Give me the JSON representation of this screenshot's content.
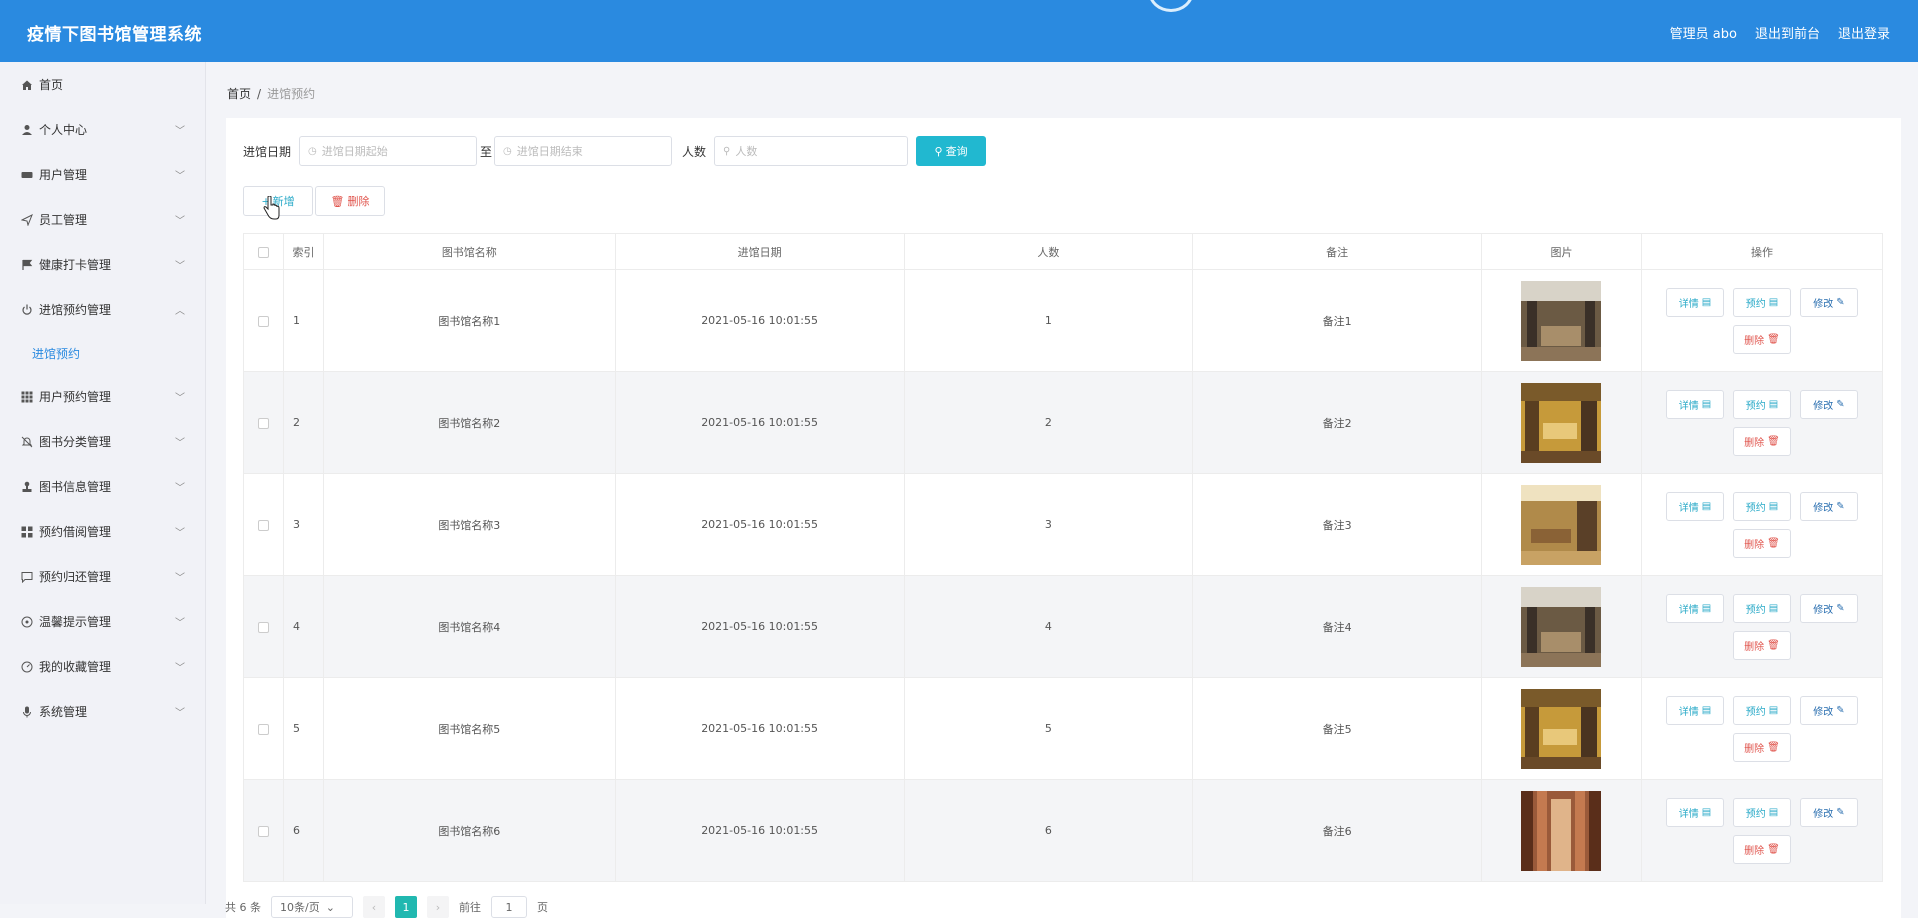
{
  "app": {
    "title": "疫情下图书馆管理系统",
    "user_label": "管理员 abo",
    "to_frontend": "退出到前台",
    "logout": "退出登录"
  },
  "sidebar": {
    "items": [
      {
        "label": "首页",
        "icon": "home-icon"
      },
      {
        "label": "个人中心",
        "icon": "user-icon"
      },
      {
        "label": "用户管理",
        "icon": "users-icon"
      },
      {
        "label": "员工管理",
        "icon": "send-icon"
      },
      {
        "label": "健康打卡管理",
        "icon": "flag-icon"
      },
      {
        "label": "进馆预约管理",
        "icon": "power-icon"
      },
      {
        "label": "用户预约管理",
        "icon": "grid-icon"
      },
      {
        "label": "图书分类管理",
        "icon": "bell-off-icon"
      },
      {
        "label": "图书信息管理",
        "icon": "stamp-icon"
      },
      {
        "label": "预约借阅管理",
        "icon": "apps-icon"
      },
      {
        "label": "预约归还管理",
        "icon": "chat-icon"
      },
      {
        "label": "温馨提示管理",
        "icon": "globe-icon"
      },
      {
        "label": "我的收藏管理",
        "icon": "speedometer-icon"
      },
      {
        "label": "系统管理",
        "icon": "mic-icon"
      }
    ],
    "subitem": "进馆预约"
  },
  "breadcrumb": {
    "home": "首页",
    "sep": "/",
    "current": "进馆预约"
  },
  "filter": {
    "date_label": "进馆日期",
    "start_placeholder": "进馆日期起始",
    "to": "至",
    "end_placeholder": "进馆日期结束",
    "people_label": "人数",
    "people_placeholder": "人数",
    "query_label": "查询"
  },
  "actions": {
    "add": "新增",
    "delete": "删除"
  },
  "table": {
    "headers": [
      "索引",
      "图书馆名称",
      "进馆日期",
      "人数",
      "备注",
      "图片",
      "操作"
    ],
    "op_labels": {
      "detail": "详情",
      "reserve": "预约",
      "edit": "修改",
      "delete": "删除"
    },
    "rows": [
      {
        "index": "1",
        "name": "图书馆名称1",
        "date": "2021-05-16 10:01:55",
        "people": "1",
        "note": "备注1"
      },
      {
        "index": "2",
        "name": "图书馆名称2",
        "date": "2021-05-16 10:01:55",
        "people": "2",
        "note": "备注2"
      },
      {
        "index": "3",
        "name": "图书馆名称3",
        "date": "2021-05-16 10:01:55",
        "people": "3",
        "note": "备注3"
      },
      {
        "index": "4",
        "name": "图书馆名称4",
        "date": "2021-05-16 10:01:55",
        "people": "4",
        "note": "备注4"
      },
      {
        "index": "5",
        "name": "图书馆名称5",
        "date": "2021-05-16 10:01:55",
        "people": "5",
        "note": "备注5"
      },
      {
        "index": "6",
        "name": "图书馆名称6",
        "date": "2021-05-16 10:01:55",
        "people": "6",
        "note": "备注6"
      }
    ]
  },
  "pager": {
    "total": "共 6 条",
    "page_size": "10条/页",
    "page": "1",
    "goto_prefix": "前往",
    "goto_value": "1",
    "goto_suffix": "页"
  },
  "colors": {
    "topbar": "#2a8ae0",
    "accent": "#21b8d0",
    "danger": "#e0534b"
  }
}
